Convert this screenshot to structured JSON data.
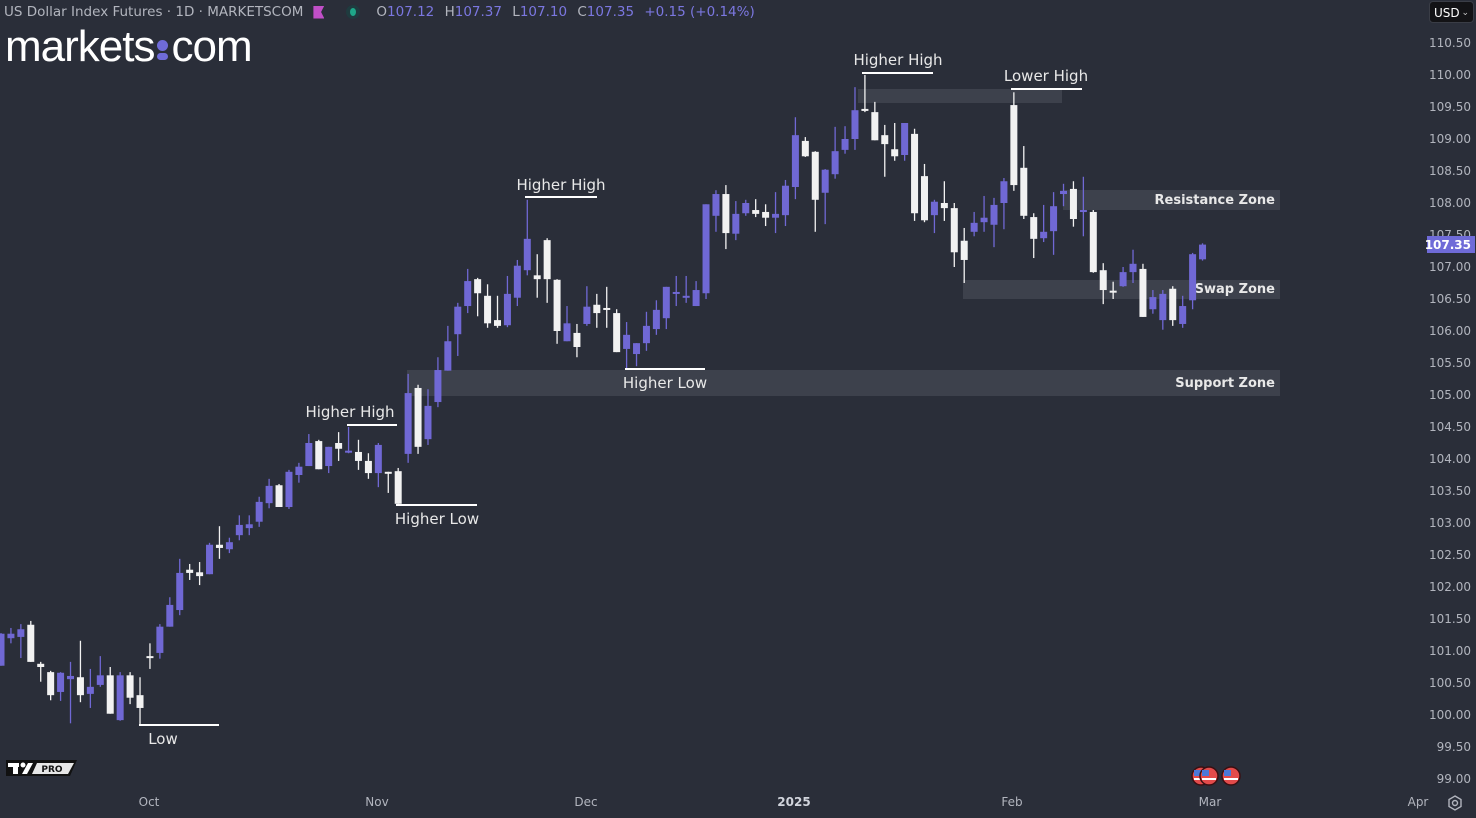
{
  "header": {
    "symbol_title": "US Dollar Index Futures · 1D · MARKETSCOM",
    "ohlc": {
      "o_label": "O",
      "o": "107.12",
      "h_label": "H",
      "h": "107.37",
      "l_label": "L",
      "l": "107.10",
      "c_label": "C",
      "c": "107.35",
      "change": "+0.15 (+0.14%)"
    }
  },
  "logo": {
    "text": "markets.com",
    "left": "markets",
    "right": "com"
  },
  "currency_selector": {
    "value": "USD"
  },
  "branding": {
    "tv_badge": "PRO"
  },
  "colors": {
    "up": "#7068d4",
    "down": "#f2f2f2",
    "background": "#2a2e39",
    "zone": "#3d414c",
    "last_price_bg": "#6f6bd8"
  },
  "icons": [
    "flag-icon",
    "status-dot-icon",
    "chevron-down-icon",
    "us-flag-event-icon",
    "gear-icon",
    "tradingview-logo-icon"
  ],
  "chart_data": {
    "type": "candlestick",
    "title": "",
    "ylim": [
      99.0,
      110.5
    ],
    "yticks": [
      "110.50",
      "110.00",
      "109.50",
      "109.00",
      "108.50",
      "108.00",
      "107.50",
      "107.00",
      "106.50",
      "106.00",
      "105.50",
      "105.00",
      "104.50",
      "104.00",
      "103.50",
      "103.00",
      "102.50",
      "102.00",
      "101.50",
      "101.00",
      "100.50",
      "100.00",
      "99.50",
      "99.00"
    ],
    "xticks": [
      "Oct",
      "Nov",
      "Dec",
      "2025",
      "Feb",
      "Mar",
      "Apr"
    ],
    "last_price": "107.35",
    "grid": false,
    "candles": [
      [
        100.77,
        101.28,
        100.77,
        101.27
      ],
      [
        101.2,
        101.36,
        101.12,
        101.27
      ],
      [
        101.22,
        101.42,
        100.89,
        101.34
      ],
      [
        101.41,
        101.47,
        100.83,
        100.83
      ],
      [
        100.8,
        100.83,
        100.52,
        100.75
      ],
      [
        100.67,
        100.69,
        100.23,
        100.31
      ],
      [
        100.36,
        100.67,
        100.22,
        100.66
      ],
      [
        100.56,
        100.83,
        99.87,
        100.61
      ],
      [
        100.59,
        101.16,
        100.2,
        100.31
      ],
      [
        100.33,
        100.72,
        100.11,
        100.44
      ],
      [
        100.47,
        100.92,
        100.44,
        100.62
      ],
      [
        100.62,
        100.75,
        100.02,
        100.02
      ],
      [
        99.92,
        100.67,
        99.91,
        100.62
      ],
      [
        100.62,
        100.67,
        100.17,
        100.27
      ],
      [
        100.31,
        100.59,
        99.86,
        100.11
      ],
      [
        100.92,
        101.12,
        100.72,
        100.91
      ],
      [
        100.97,
        101.42,
        100.88,
        101.38
      ],
      [
        101.38,
        101.84,
        101.38,
        101.72
      ],
      [
        101.64,
        102.44,
        101.56,
        102.22
      ],
      [
        102.27,
        102.36,
        102.11,
        102.22
      ],
      [
        102.23,
        102.39,
        102.03,
        102.17
      ],
      [
        102.2,
        102.69,
        102.2,
        102.66
      ],
      [
        102.66,
        102.95,
        102.44,
        102.61
      ],
      [
        102.59,
        102.77,
        102.53,
        102.7
      ],
      [
        102.81,
        103.12,
        102.73,
        102.97
      ],
      [
        102.92,
        103.12,
        102.81,
        102.98
      ],
      [
        103.02,
        103.41,
        102.94,
        103.33
      ],
      [
        103.31,
        103.69,
        103.23,
        103.58
      ],
      [
        103.59,
        103.61,
        103.25,
        103.25
      ],
      [
        103.25,
        103.83,
        103.22,
        103.8
      ],
      [
        103.75,
        103.94,
        103.63,
        103.88
      ],
      [
        103.89,
        104.39,
        103.89,
        104.25
      ],
      [
        104.28,
        104.3,
        103.84,
        103.84
      ],
      [
        103.89,
        104.19,
        103.78,
        104.19
      ],
      [
        104.25,
        104.42,
        103.97,
        104.16
      ],
      [
        104.11,
        104.5,
        104.09,
        104.13
      ],
      [
        104.11,
        104.3,
        103.83,
        103.97
      ],
      [
        103.97,
        104.09,
        103.69,
        103.78
      ],
      [
        103.78,
        104.25,
        103.56,
        104.22
      ],
      [
        103.8,
        103.8,
        103.47,
        103.79
      ],
      [
        103.81,
        103.86,
        103.3,
        103.3
      ],
      [
        104.08,
        105.33,
        103.94,
        105.03
      ],
      [
        105.11,
        105.16,
        104.08,
        104.19
      ],
      [
        104.31,
        105.09,
        104.22,
        104.83
      ],
      [
        104.89,
        105.59,
        104.81,
        105.39
      ],
      [
        105.38,
        106.08,
        105.38,
        105.84
      ],
      [
        105.95,
        106.44,
        105.61,
        106.38
      ],
      [
        106.39,
        106.97,
        106.28,
        106.78
      ],
      [
        106.81,
        106.83,
        106.23,
        106.59
      ],
      [
        106.55,
        106.73,
        106.05,
        106.12
      ],
      [
        106.17,
        106.55,
        106.05,
        106.08
      ],
      [
        106.09,
        106.86,
        106.06,
        106.58
      ],
      [
        106.52,
        107.11,
        106.39,
        107.02
      ],
      [
        106.95,
        108.05,
        106.87,
        107.44
      ],
      [
        106.87,
        107.2,
        106.52,
        106.81
      ],
      [
        107.42,
        107.45,
        106.44,
        106.81
      ],
      [
        106.8,
        106.81,
        105.8,
        106.0
      ],
      [
        105.84,
        106.39,
        105.84,
        106.12
      ],
      [
        105.97,
        106.11,
        105.59,
        105.75
      ],
      [
        106.11,
        106.7,
        106.08,
        106.38
      ],
      [
        106.41,
        106.58,
        106.05,
        106.28
      ],
      [
        106.36,
        106.69,
        106.05,
        106.33
      ],
      [
        106.28,
        106.34,
        105.67,
        105.67
      ],
      [
        105.72,
        106.14,
        105.41,
        105.94
      ],
      [
        105.64,
        105.81,
        105.45,
        105.81
      ],
      [
        105.81,
        106.3,
        105.69,
        106.08
      ],
      [
        106.03,
        106.48,
        105.94,
        106.33
      ],
      [
        106.2,
        106.69,
        106.03,
        106.69
      ],
      [
        106.59,
        106.86,
        106.39,
        106.61
      ],
      [
        106.53,
        106.86,
        106.44,
        106.55
      ],
      [
        106.39,
        106.78,
        106.39,
        106.64
      ],
      [
        106.59,
        107.98,
        106.5,
        107.98
      ],
      [
        107.8,
        108.2,
        107.55,
        108.14
      ],
      [
        108.14,
        108.28,
        107.28,
        107.53
      ],
      [
        107.52,
        108.03,
        107.42,
        107.83
      ],
      [
        107.84,
        108.05,
        107.8,
        108.0
      ],
      [
        107.89,
        108.06,
        107.78,
        107.83
      ],
      [
        107.86,
        107.98,
        107.64,
        107.77
      ],
      [
        107.77,
        108.17,
        107.53,
        107.83
      ],
      [
        107.81,
        108.36,
        107.64,
        108.27
      ],
      [
        108.25,
        109.34,
        108.06,
        109.06
      ],
      [
        108.97,
        109.03,
        108.72,
        108.73
      ],
      [
        108.8,
        108.81,
        107.55,
        108.05
      ],
      [
        108.16,
        108.53,
        107.67,
        108.52
      ],
      [
        108.45,
        109.19,
        108.38,
        108.81
      ],
      [
        108.83,
        109.2,
        108.77,
        109.0
      ],
      [
        109.0,
        109.81,
        108.83,
        109.45
      ],
      [
        109.47,
        110.0,
        109.42,
        109.45
      ],
      [
        109.42,
        109.58,
        108.98,
        108.98
      ],
      [
        109.06,
        109.22,
        108.41,
        108.92
      ],
      [
        108.84,
        109.25,
        108.66,
        108.73
      ],
      [
        108.75,
        109.25,
        108.66,
        109.25
      ],
      [
        109.08,
        109.16,
        107.72,
        107.84
      ],
      [
        108.42,
        108.61,
        107.7,
        107.73
      ],
      [
        107.81,
        108.05,
        107.53,
        108.02
      ],
      [
        108.0,
        108.34,
        107.72,
        107.92
      ],
      [
        107.92,
        108.0,
        107.0,
        107.23
      ],
      [
        107.41,
        107.61,
        106.75,
        107.11
      ],
      [
        107.55,
        107.86,
        107.48,
        107.69
      ],
      [
        107.7,
        108.11,
        107.55,
        107.77
      ],
      [
        107.66,
        108.08,
        107.31,
        107.97
      ],
      [
        108.0,
        108.39,
        107.59,
        108.34
      ],
      [
        109.53,
        109.73,
        108.19,
        108.28
      ],
      [
        108.55,
        108.89,
        107.75,
        107.8
      ],
      [
        107.78,
        107.84,
        107.14,
        107.44
      ],
      [
        107.45,
        107.97,
        107.39,
        107.55
      ],
      [
        107.56,
        108.17,
        107.19,
        107.95
      ],
      [
        108.14,
        108.3,
        107.95,
        108.19
      ],
      [
        108.22,
        108.34,
        107.63,
        107.75
      ],
      [
        107.88,
        108.41,
        107.48,
        107.89
      ],
      [
        107.86,
        107.89,
        106.91,
        106.92
      ],
      [
        106.95,
        107.06,
        106.42,
        106.64
      ],
      [
        106.63,
        106.77,
        106.5,
        106.62
      ],
      [
        106.7,
        107.0,
        106.69,
        106.92
      ],
      [
        106.92,
        107.27,
        106.75,
        107.05
      ],
      [
        106.97,
        107.05,
        106.22,
        106.22
      ],
      [
        106.34,
        106.64,
        106.27,
        106.53
      ],
      [
        106.17,
        106.64,
        106.02,
        106.58
      ],
      [
        106.66,
        106.7,
        106.08,
        106.17
      ],
      [
        106.11,
        106.55,
        106.05,
        106.39
      ],
      [
        106.48,
        107.22,
        106.34,
        107.2
      ],
      [
        107.12,
        107.37,
        107.1,
        107.35
      ]
    ],
    "candle_fields": [
      "open",
      "high",
      "low",
      "close"
    ],
    "zones": [
      {
        "label": "",
        "top": 109.78,
        "bottom": 109.56
      },
      {
        "label": "Resistance Zone",
        "top": 108.2,
        "bottom": 107.89
      },
      {
        "label": "Swap Zone",
        "top": 106.8,
        "bottom": 106.5
      },
      {
        "label": "Support Zone",
        "top": 105.39,
        "bottom": 104.98
      }
    ],
    "annotations": [
      {
        "label": "Low",
        "price": 99.84
      },
      {
        "label": "Higher High",
        "price": 104.53
      },
      {
        "label": "Higher Low",
        "price": 103.28
      },
      {
        "label": "Higher High",
        "price": 108.09
      },
      {
        "label": "Higher Low",
        "price": 105.41
      },
      {
        "label": "Higher High",
        "price": 110.03
      },
      {
        "label": "Lower High",
        "price": 109.78
      }
    ]
  }
}
